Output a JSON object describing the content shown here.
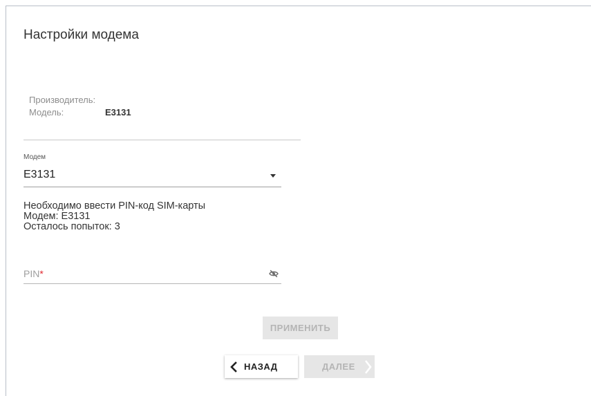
{
  "page": {
    "title": "Настройки модема"
  },
  "device_info": {
    "manufacturer_label": "Производитель:",
    "manufacturer_value": "",
    "model_label": "Модель:",
    "model_value": "E3131"
  },
  "modem_select": {
    "label": "Модем",
    "value": "E3131",
    "icon": "caret-down-icon"
  },
  "pin_message": {
    "line1": "Необходимо ввести PIN-код SIM-карты",
    "line2": "Модем: E3131",
    "line3": "Осталось попыток: 3"
  },
  "pin_field": {
    "placeholder": "PIN",
    "required_mark": "*",
    "value": "",
    "visibility_icon": "eye-off-icon"
  },
  "buttons": {
    "apply_label": "ПРИМЕНИТЬ",
    "back_label": "НАЗАД",
    "next_label": "ДАЛЕЕ"
  },
  "colors": {
    "required": "#e0282f",
    "disabled_bg": "#e6e6e6",
    "disabled_text": "#b4b4b4",
    "frame_border": "#b7bec7"
  }
}
